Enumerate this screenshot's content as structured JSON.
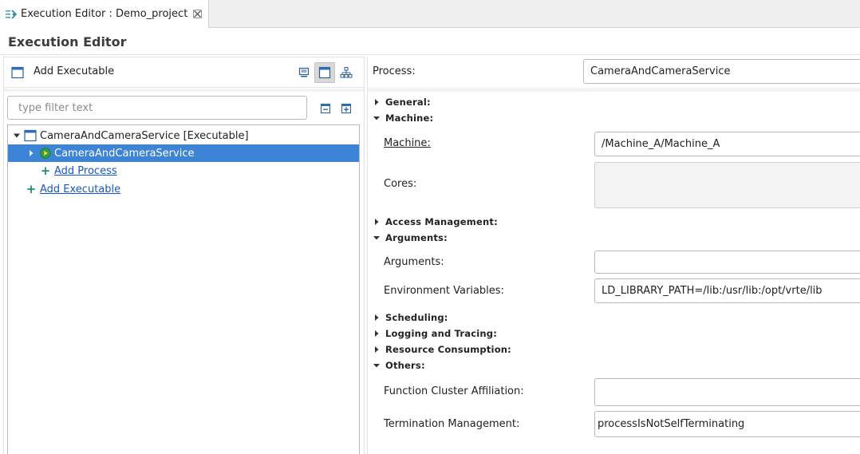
{
  "tab": {
    "title": "Execution Editor : Demo_project"
  },
  "page": {
    "title": "Execution Editor"
  },
  "left": {
    "add_executable_label": "Add Executable",
    "filter_placeholder": "type filter text",
    "tree": {
      "root_label": "CameraAndCameraService [Executable]",
      "child_label": "CameraAndCameraService",
      "add_process_link": "Add Process",
      "add_executable_link": "Add Executable"
    }
  },
  "right": {
    "process_label": "Process:",
    "process_value": "CameraAndCameraService",
    "sections": {
      "general": "General:",
      "machine": "Machine:",
      "access_management": "Access Management:",
      "arguments": "Arguments:",
      "scheduling": "Scheduling:",
      "logging": "Logging and Tracing:",
      "resource": "Resource Consumption:",
      "others": "Others:"
    },
    "fields": {
      "machine_link": "Machine:",
      "machine_value": "/Machine_A/Machine_A",
      "cores_label": "Cores:",
      "cores_value": "",
      "arguments_label": "Arguments:",
      "arguments_value": "",
      "env_label": "Environment Variables:",
      "env_value": "LD_LIBRARY_PATH=/lib:/usr/lib:/opt/vrte/lib",
      "fca_label": "Function Cluster Affiliation:",
      "fca_value": "",
      "termination_label": "Termination Management:",
      "termination_value": "processIsNotSelfTerminating"
    }
  },
  "colors": {
    "selection": "#3d83d6",
    "link": "#1a56c8",
    "add_plus": "#1e8f6f",
    "run_icon": "#2e9e3e"
  },
  "icons": [
    "editor-icon",
    "close-icon",
    "window-icon",
    "monitor-icon",
    "hierarchy-icon",
    "collapse-all-icon",
    "expand-all-icon",
    "run-process-icon"
  ]
}
